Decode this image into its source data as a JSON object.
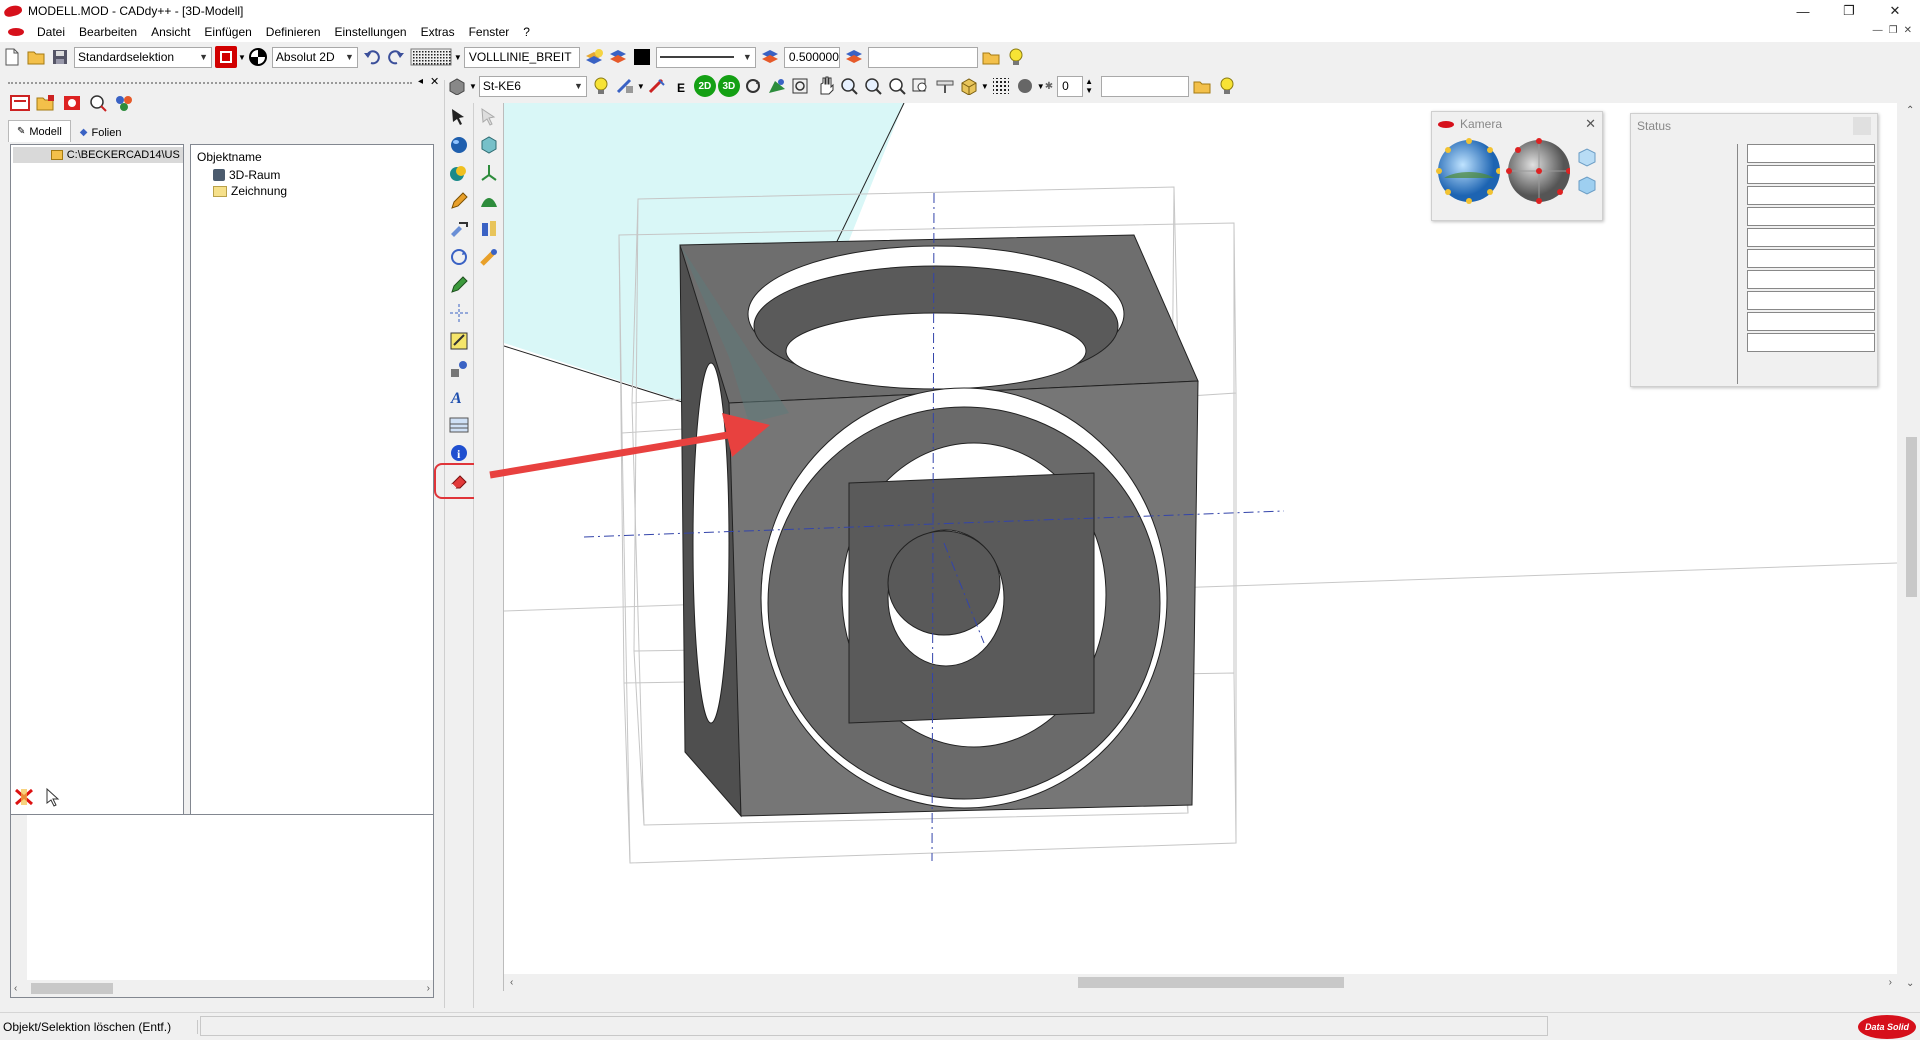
{
  "window": {
    "title": "MODELL.MOD  -  CADdy++ - [3D-Modell]"
  },
  "menu": [
    "Datei",
    "Bearbeiten",
    "Ansicht",
    "Einfügen",
    "Definieren",
    "Einstellungen",
    "Extras",
    "Fenster",
    "?"
  ],
  "toolbar1": {
    "selection_mode": "Standardselektion",
    "coordinate_mode": "Absolut 2D",
    "line_type": "VOLLLINIE_BREIT",
    "line_width": "0.500000",
    "layer_field": ""
  },
  "toolbar2": {
    "material": "St-KE6",
    "view_2d": "2D",
    "view_3d": "3D",
    "counter_value": "0",
    "extra_field": ""
  },
  "left_panel": {
    "tabs": [
      "Modell",
      "Folien"
    ],
    "tree_path": "C:\\BECKERCAD14\\US",
    "object_header": "Objektname",
    "objects": [
      "3D-Raum",
      "Zeichnung"
    ]
  },
  "camera_panel": {
    "title": "Kamera"
  },
  "status_panel": {
    "title": "Status"
  },
  "statusbar": {
    "text": "Objekt/Selektion löschen (Entf.)"
  },
  "brand": {
    "logo_text": "Data Solid"
  },
  "colors": {
    "accent_red": "#d6101b",
    "highlight_box": "#e0353a",
    "arrow": "#e8413f",
    "section_plane": "#d9f7f7"
  }
}
